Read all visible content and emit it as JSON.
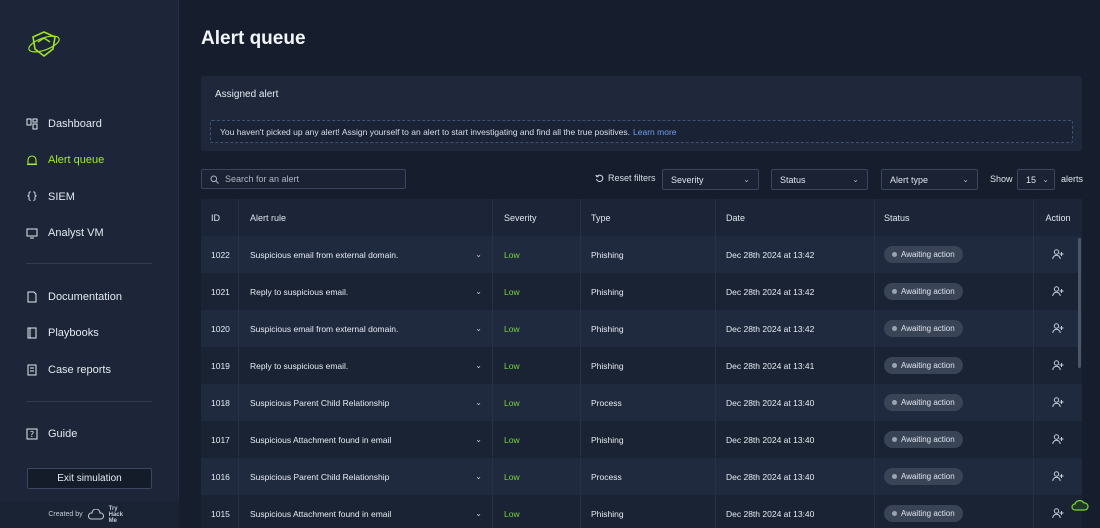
{
  "sidebar": {
    "nav": [
      {
        "label": "Dashboard",
        "icon": "dashboard-icon"
      },
      {
        "label": "Alert queue",
        "icon": "alert-queue-icon",
        "active": true
      },
      {
        "label": "SIEM",
        "icon": "siem-icon"
      },
      {
        "label": "Analyst VM",
        "icon": "monitor-icon"
      }
    ],
    "docs": [
      {
        "label": "Documentation",
        "icon": "document-icon"
      },
      {
        "label": "Playbooks",
        "icon": "book-icon"
      },
      {
        "label": "Case reports",
        "icon": "report-icon"
      }
    ],
    "guide": {
      "label": "Guide",
      "icon": "help-icon"
    },
    "exit_label": "Exit simulation",
    "created_by": "Created by",
    "created_logo_text": "Try Hack Me"
  },
  "page": {
    "title": "Alert queue"
  },
  "assigned": {
    "title": "Assigned alert",
    "message": "You haven't picked up any alert! Assign yourself to an alert to start investigating and find all the true positives.",
    "link": "Learn more"
  },
  "toolbar": {
    "search_placeholder": "Search for an alert",
    "reset_label": "Reset filters",
    "severity_label": "Severity",
    "status_label": "Status",
    "alert_type_label": "Alert type",
    "show_label": "Show",
    "show_value": "15",
    "alerts_label": "alerts"
  },
  "table": {
    "headers": {
      "id": "ID",
      "rule": "Alert rule",
      "severity": "Severity",
      "type": "Type",
      "date": "Date",
      "status": "Status",
      "action": "Action"
    },
    "rows": [
      {
        "id": "1022",
        "rule": "Suspicious email from external domain.",
        "severity": "Low",
        "type": "Phishing",
        "date": "Dec 28th 2024 at 13:42",
        "status": "Awaiting action"
      },
      {
        "id": "1021",
        "rule": "Reply to suspicious email.",
        "severity": "Low",
        "type": "Phishing",
        "date": "Dec 28th 2024 at 13:42",
        "status": "Awaiting action"
      },
      {
        "id": "1020",
        "rule": "Suspicious email from external domain.",
        "severity": "Low",
        "type": "Phishing",
        "date": "Dec 28th 2024 at 13:42",
        "status": "Awaiting action"
      },
      {
        "id": "1019",
        "rule": "Reply to suspicious email.",
        "severity": "Low",
        "type": "Phishing",
        "date": "Dec 28th 2024 at 13:41",
        "status": "Awaiting action"
      },
      {
        "id": "1018",
        "rule": "Suspicious Parent Child Relationship",
        "severity": "Low",
        "type": "Process",
        "date": "Dec 28th 2024 at 13:40",
        "status": "Awaiting action"
      },
      {
        "id": "1017",
        "rule": "Suspicious Attachment found in email",
        "severity": "Low",
        "type": "Phishing",
        "date": "Dec 28th 2024 at 13:40",
        "status": "Awaiting action"
      },
      {
        "id": "1016",
        "rule": "Suspicious Parent Child Relationship",
        "severity": "Low",
        "type": "Process",
        "date": "Dec 28th 2024 at 13:40",
        "status": "Awaiting action"
      },
      {
        "id": "1015",
        "rule": "Suspicious Attachment found in email",
        "severity": "Low",
        "type": "Phishing",
        "date": "Dec 28th 2024 at 13:40",
        "status": "Awaiting action"
      }
    ]
  },
  "colors": {
    "accent": "#a3ea2a",
    "severity_low": "#7ad33b",
    "link": "#6c9ef0"
  }
}
